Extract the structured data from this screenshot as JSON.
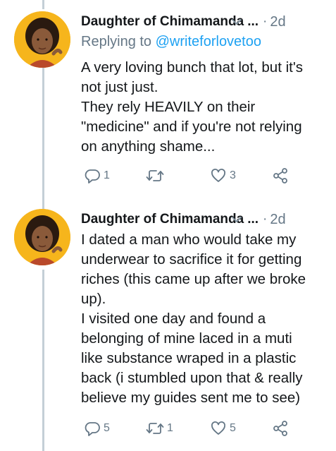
{
  "tweets": [
    {
      "author": "Daughter of Chimamanda",
      "ellipsis": "...",
      "time": "2d",
      "reply_prefix": "Replying to ",
      "reply_handle": "@writeforlovetoo",
      "lines": [
        "A very loving bunch that lot, but it's",
        "not just just.",
        "They rely HEAVILY on their",
        "\"medicine\" and if you're not relying",
        "on anything shame..."
      ],
      "reply_count": "1",
      "retweet_count": "",
      "like_count": "3"
    },
    {
      "author": "Daughter of Chimamanda",
      "ellipsis": "...",
      "time": "2d",
      "lines": [
        "I dated a man who would take my",
        "underwear to sacrifice it for getting",
        "riches (this came up after we broke",
        "up).",
        "I visited one day and found a",
        "belonging of mine laced in a muti",
        "like substance wraped in a plastic",
        "back (i stumbled upon that & really",
        "believe my guides sent me to see)"
      ],
      "reply_count": "5",
      "retweet_count": "1",
      "like_count": "5"
    }
  ],
  "colors": {
    "accent": "#1da1f2",
    "muted": "#657786",
    "avatar_bg": "#f6b51c",
    "thread_line": "#c4cfd6"
  },
  "icons": [
    "reply-icon",
    "retweet-icon",
    "like-icon",
    "share-icon",
    "chevron-down-icon"
  ]
}
